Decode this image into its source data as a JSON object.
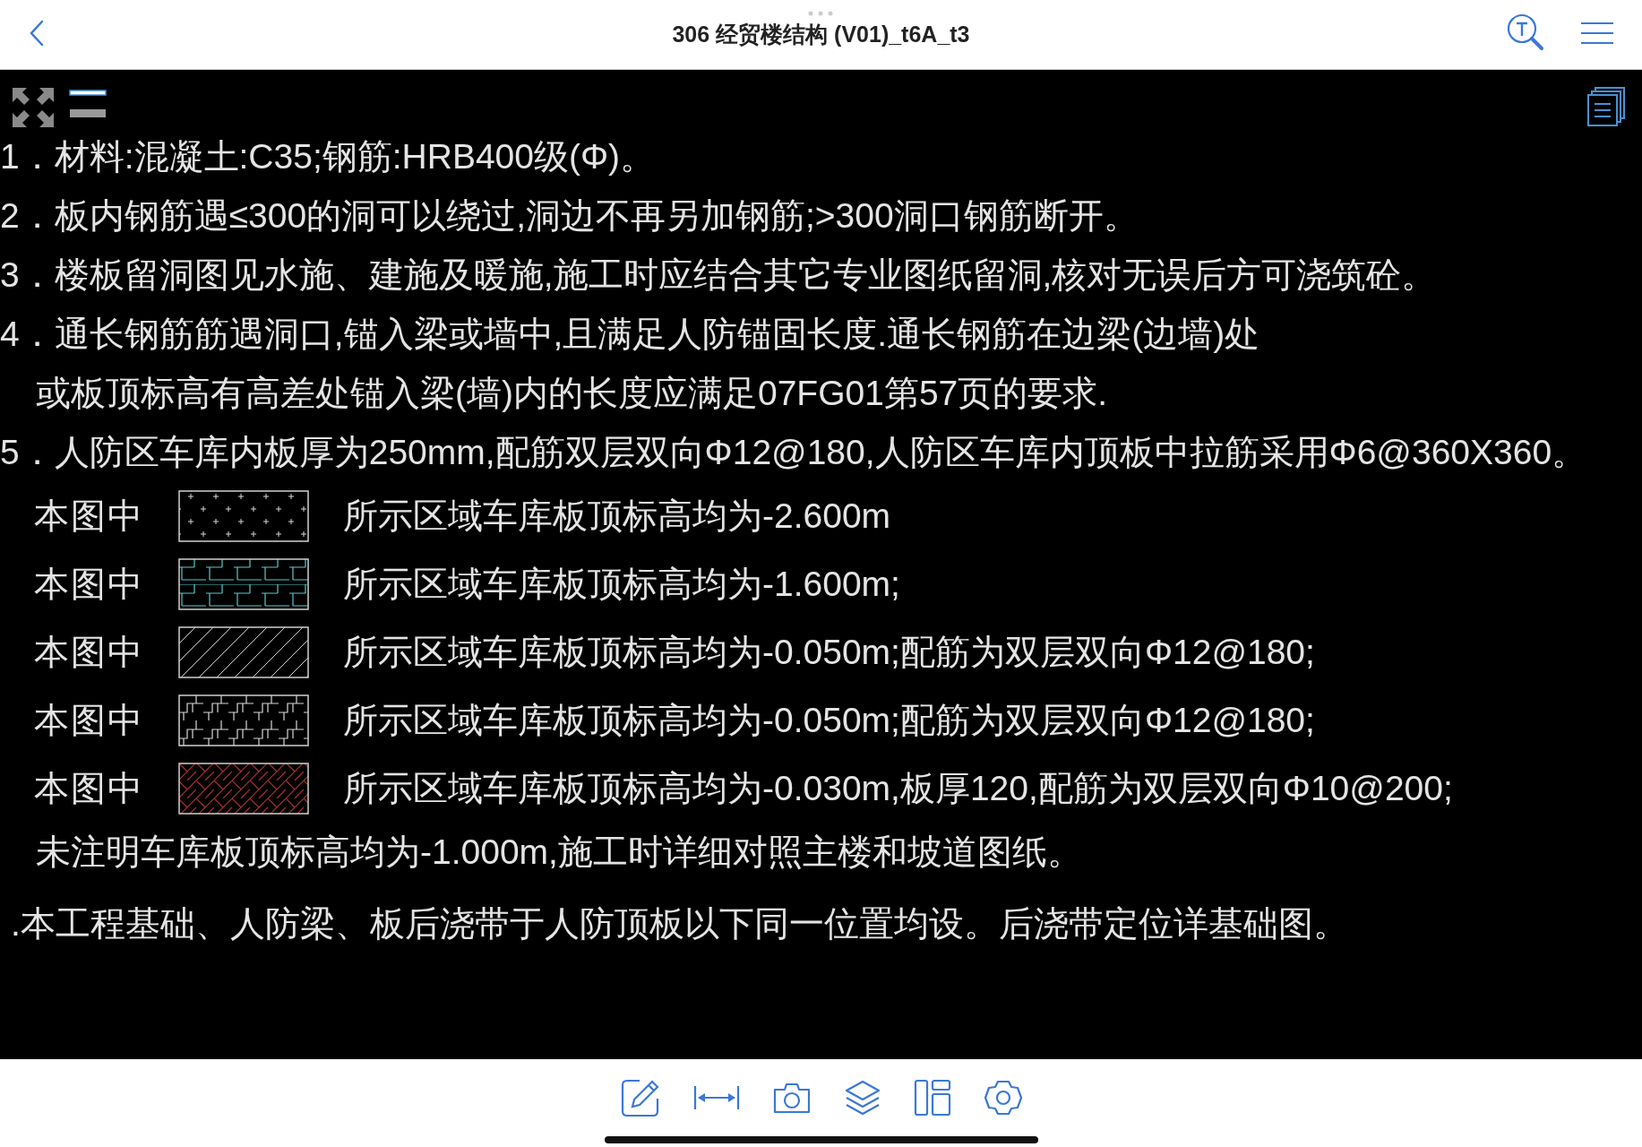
{
  "top_bar": {
    "title": "306 经贸楼结构 (V01)_t6A_t3"
  },
  "drawing_lines": [
    {
      "kind": "note",
      "text": "1．材料:混凝土:C35;钢筋:HRB400级(Φ)。"
    },
    {
      "kind": "note",
      "text": "2．板内钢筋遇≤300的洞可以绕过,洞边不再另加钢筋;>300洞口钢筋断开。"
    },
    {
      "kind": "note",
      "text": "3．楼板留洞图见水施、建施及暖施,施工时应结合其它专业图纸留洞,核对无误后方可浇筑砼。"
    },
    {
      "kind": "note",
      "text": "4．通长钢筋筋遇洞口,锚入梁或墙中,且满足人防锚固长度.通长钢筋在边梁(边墙)处"
    },
    {
      "kind": "continuation",
      "text": "或板顶标高有高差处锚入梁(墙)内的长度应满足07FG01第57页的要求."
    },
    {
      "kind": "note",
      "text": "5．人防区车库内板厚为250mm,配筋双层双向Φ12@180,人防区车库内顶板中拉筋采用Φ6@360X360。"
    },
    {
      "kind": "legend",
      "label": "本图中",
      "swatch": {
        "kind": "crosses"
      },
      "text": "所示区域车库板顶标高均为-2.600m"
    },
    {
      "kind": "legend",
      "label": "本图中",
      "swatch": {
        "kind": "brick"
      },
      "text": "所示区域车库板顶标高均为-1.600m;"
    },
    {
      "kind": "legend",
      "label": "本图中",
      "swatch": {
        "kind": "hatch"
      },
      "text": "所示区域车库板顶标高均为-0.050m;配筋为双层双向Φ12@180;"
    },
    {
      "kind": "legend",
      "label": "本图中",
      "swatch": {
        "kind": "steps"
      },
      "text": "所示区域车库板顶标高均为-0.050m;配筋为双层双向Φ12@180;"
    },
    {
      "kind": "legend",
      "label": "本图中",
      "swatch": {
        "kind": "herringbone"
      },
      "text": "所示区域车库板顶标高均为-0.030m,板厚120,配筋为双层双向Φ10@200;"
    },
    {
      "kind": "continuation",
      "text": "未注明车库板顶标高均为-1.000m,施工时详细对照主楼和坡道图纸。"
    },
    {
      "kind": "tail",
      "text": ".本工程基础、人防梁、板后浇带于人防顶板以下同一位置均设。后浇带定位详基础图。"
    }
  ]
}
